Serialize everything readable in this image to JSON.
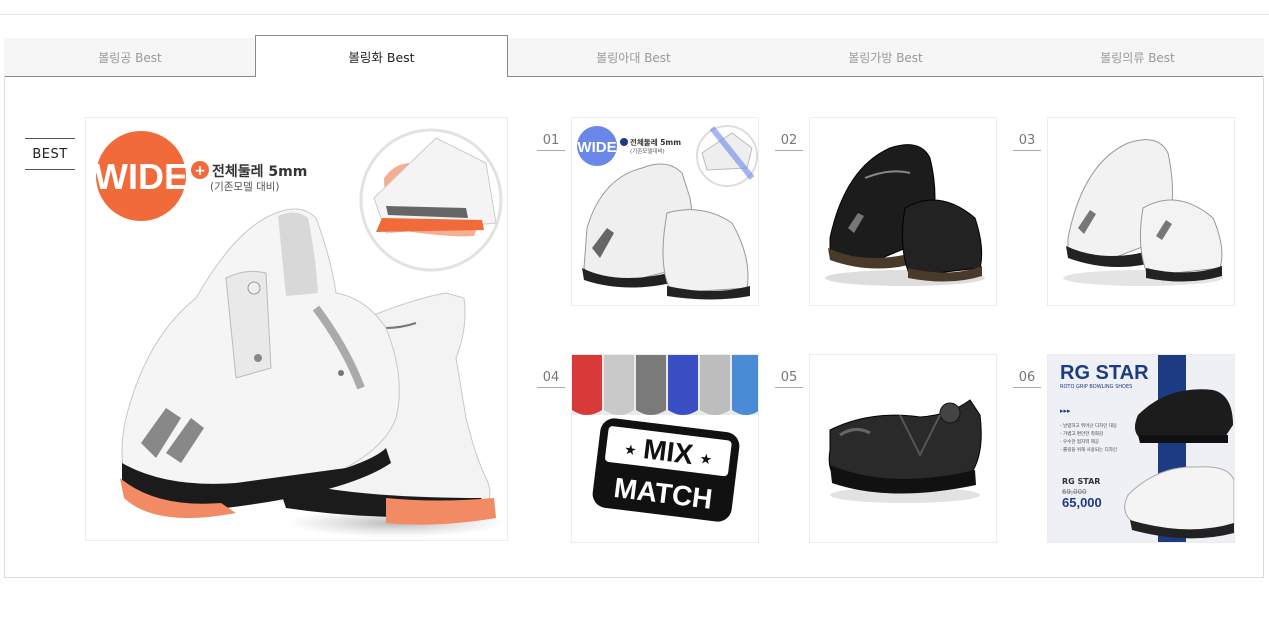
{
  "tabs": [
    {
      "label": "볼링공 Best",
      "active": false
    },
    {
      "label": "볼링화 Best",
      "active": true
    },
    {
      "label": "볼링아대 Best",
      "active": false
    },
    {
      "label": "볼링가방 Best",
      "active": false
    },
    {
      "label": "볼링의류 Best",
      "active": false
    }
  ],
  "best_label": "BEST",
  "feature": {
    "badge": "WIDE",
    "headline": "전체둘레 5mm",
    "subline": "(기존모델 대비)"
  },
  "items": [
    {
      "num": "01",
      "badge": "WIDE",
      "text": "전체둘레 5mm",
      "subtext": "(기존모델대비)"
    },
    {
      "num": "02"
    },
    {
      "num": "03"
    },
    {
      "num": "04",
      "mix": "MIX",
      "match": "MATCH"
    },
    {
      "num": "05"
    },
    {
      "num": "06",
      "title": "RG STAR",
      "subtitle": "ROTO GRIP BOWLING SHOES",
      "arrows": "▸▸▸",
      "bullets": [
        "- 날렵하고 뛰어난 디자인 대응",
        "- 가볍고 편안한 착화감",
        "- 우수한 접지력 제공",
        "- 롤링을 위해 사용되는 디자인"
      ],
      "model": "RG STAR",
      "old_price": "69,000",
      "price": "65,000"
    }
  ],
  "colors": {
    "wide_orange": "#f06a3a",
    "wide_blue": "#6a86e8",
    "rg_navy": "#1d3b83"
  }
}
